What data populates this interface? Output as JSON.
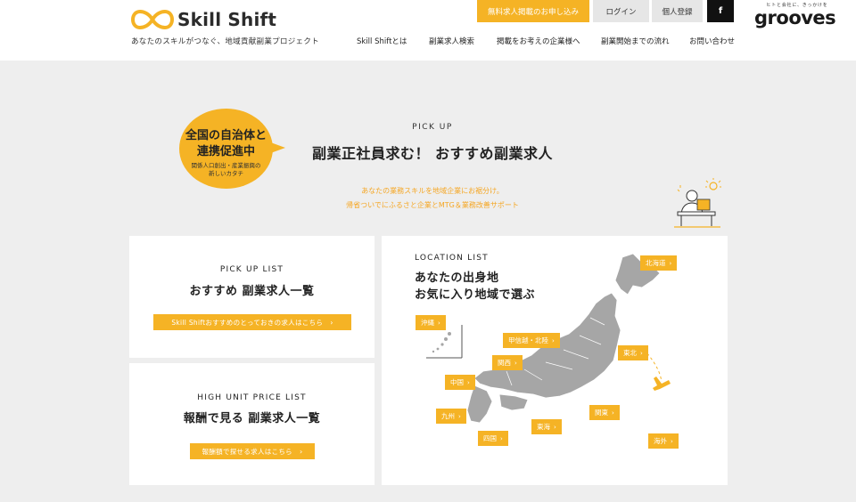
{
  "header": {
    "logo_text": "Skill Shift",
    "tagline": "あなたのスキルがつなぐ、地域貢献副業プロジェクト",
    "top_buttons": {
      "listing": "無料求人掲載のお申し込み",
      "login": "ログイン",
      "register": "個人登録",
      "facebook": "f"
    },
    "grooves_small": "ヒトと会社に、きっかけを",
    "grooves_logo": "grooves",
    "nav": [
      "Skill Shiftとは",
      "副業求人検索",
      "掲載をお考えの企業様へ",
      "副業開始までの流れ",
      "お問い合わせ"
    ]
  },
  "hero": {
    "badge_line1": "全国の自治体と",
    "badge_line2": "連携促進中",
    "badge_line3": "関係人口創出・産業振興の",
    "badge_line4": "新しいカタチ",
    "pickup_label": "PICK UP",
    "title": "副業正社員求む！ おすすめ副業求人",
    "sub1": "あなたの業務スキルを地域企業にお裾分け。",
    "sub2": "帰省ついでにふるさと企業とMTG＆業務改善サポート"
  },
  "pickup_card": {
    "label": "PICK UP LIST",
    "title": "おすすめ 副業求人一覧",
    "button": "Skill Shiftおすすめのとっておきの求人はこちら",
    "arrow": "›"
  },
  "high_card": {
    "label": "HIGH UNIT PRICE LIST",
    "title": "報酬で見る 副業求人一覧",
    "button": "報酬額で探せる求人はこちら",
    "arrow": "›"
  },
  "location_card": {
    "label": "LOCATION LIST",
    "title1": "あなたの出身地",
    "title2": "お気に入り地域で選ぶ",
    "regions": {
      "hokkaido": "北海道",
      "okinawa": "沖縄",
      "koshinetsu": "甲信越・北陸",
      "tohoku": "東北",
      "kansai": "関西",
      "chugoku": "中国",
      "kanto": "関東",
      "kyushu": "九州",
      "tokai": "東海",
      "shikoku": "四国",
      "overseas": "海外"
    },
    "arrow": "›"
  },
  "colors": {
    "accent": "#f5b325",
    "background": "#eeeeee",
    "card": "#ffffff",
    "map": "#a6a6a6"
  },
  "icons": [
    "infinity-logo-icon",
    "facebook-icon",
    "person-at-desk-illustration",
    "lightbulb-icon",
    "airplane-icon",
    "japan-map"
  ]
}
